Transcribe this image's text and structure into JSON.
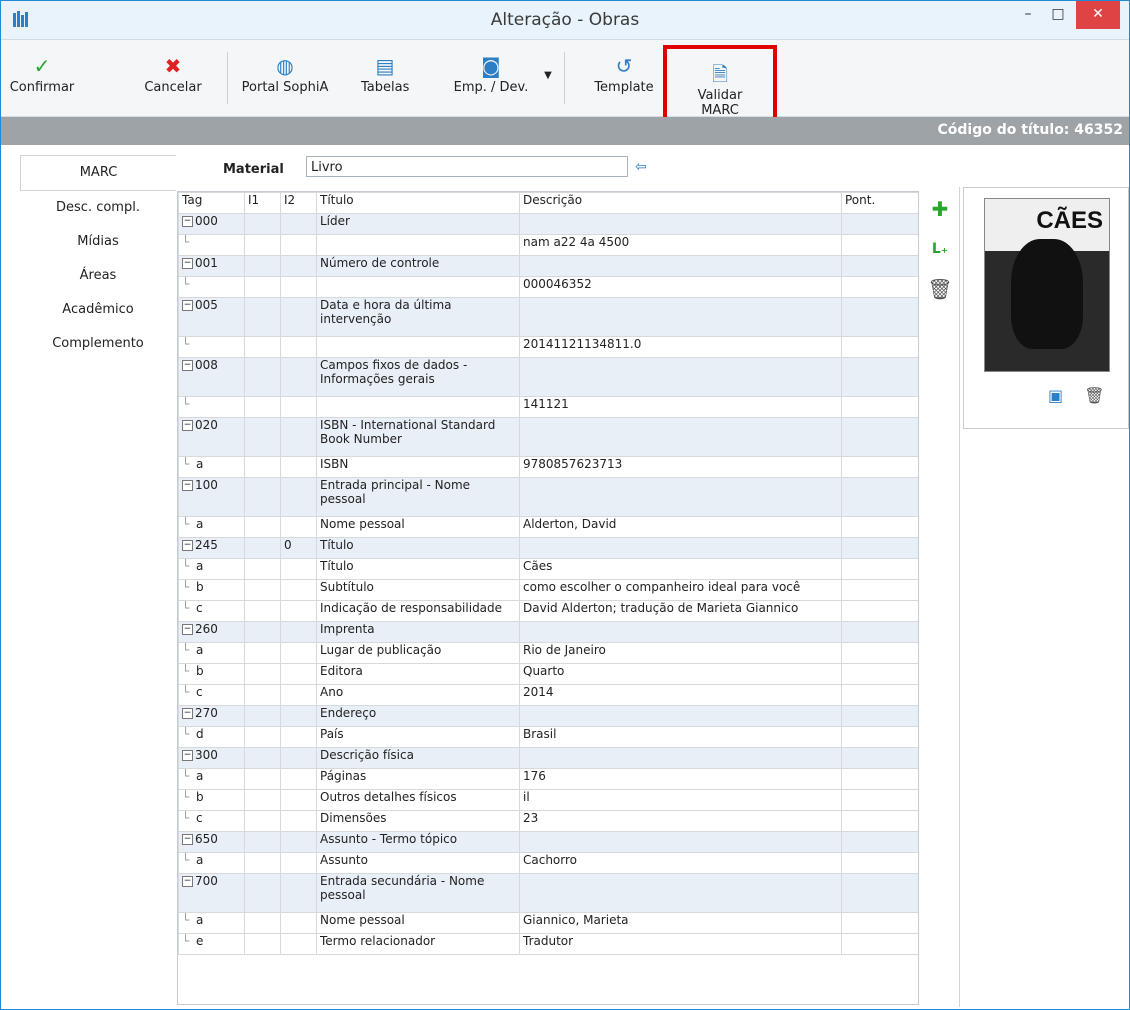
{
  "window": {
    "title": "Alteração - Obras"
  },
  "toolbar": {
    "confirmar": "Confirmar",
    "cancelar": "Cancelar",
    "portal": "Portal SophiA",
    "tabelas": "Tabelas",
    "emp": "Emp. / Dev.",
    "template": "Template",
    "validar": "Validar MARC"
  },
  "header": {
    "codigo": "Código do título: 46352"
  },
  "sidebar": {
    "items": [
      {
        "label": "MARC"
      },
      {
        "label": "Desc. compl."
      },
      {
        "label": "Mídias"
      },
      {
        "label": "Áreas"
      },
      {
        "label": "Acadêmico"
      },
      {
        "label": "Complemento"
      }
    ]
  },
  "material": {
    "label": "Material",
    "value": "Livro"
  },
  "grid": {
    "headers": {
      "tag": "Tag",
      "i1": "I1",
      "i2": "I2",
      "titulo": "Título",
      "descricao": "Descrição",
      "pont": "Pont."
    },
    "rows": [
      {
        "type": "field",
        "tag": "000",
        "i1": "",
        "i2": "",
        "titulo": "Líder",
        "descricao": ""
      },
      {
        "type": "sub",
        "tag": "",
        "i1": "",
        "i2": "",
        "titulo": "",
        "descricao": "nam a22    4a 4500"
      },
      {
        "type": "field",
        "tag": "001",
        "i1": "",
        "i2": "",
        "titulo": "Número de controle",
        "descricao": ""
      },
      {
        "type": "sub",
        "tag": "",
        "i1": "",
        "i2": "",
        "titulo": "",
        "descricao": "000046352"
      },
      {
        "type": "field",
        "tag": "005",
        "i1": "",
        "i2": "",
        "titulo": "Data e hora da última intervenção",
        "descricao": ""
      },
      {
        "type": "sub",
        "tag": "",
        "i1": "",
        "i2": "",
        "titulo": "",
        "descricao": "20141121134811.0"
      },
      {
        "type": "field",
        "tag": "008",
        "i1": "",
        "i2": "",
        "titulo": "Campos fixos de dados - Informações gerais",
        "descricao": ""
      },
      {
        "type": "sub",
        "tag": "",
        "i1": "",
        "i2": "",
        "titulo": "",
        "descricao": "141121"
      },
      {
        "type": "field",
        "tag": "020",
        "i1": "",
        "i2": "",
        "titulo": "ISBN - International Standard Book Number",
        "descricao": ""
      },
      {
        "type": "sub",
        "tag": "a",
        "i1": "",
        "i2": "",
        "titulo": "ISBN",
        "descricao": "9780857623713"
      },
      {
        "type": "field",
        "tag": "100",
        "i1": "",
        "i2": "",
        "titulo": "Entrada principal - Nome pessoal",
        "descricao": ""
      },
      {
        "type": "sub",
        "tag": "a",
        "i1": "",
        "i2": "",
        "titulo": "Nome pessoal",
        "descricao": "Alderton, David"
      },
      {
        "type": "field",
        "tag": "245",
        "i1": "",
        "i2": "0",
        "titulo": "Título",
        "descricao": ""
      },
      {
        "type": "sub",
        "tag": "a",
        "i1": "",
        "i2": "",
        "titulo": "Título",
        "descricao": "Cães"
      },
      {
        "type": "sub",
        "tag": "b",
        "i1": "",
        "i2": "",
        "titulo": "Subtítulo",
        "descricao": "como escolher o companheiro ideal para você"
      },
      {
        "type": "sub",
        "tag": "c",
        "i1": "",
        "i2": "",
        "titulo": "Indicação de responsabilidade",
        "descricao": "David Alderton; tradução de Marieta Giannico"
      },
      {
        "type": "field",
        "tag": "260",
        "i1": "",
        "i2": "",
        "titulo": "Imprenta",
        "descricao": ""
      },
      {
        "type": "sub",
        "tag": "a",
        "i1": "",
        "i2": "",
        "titulo": "Lugar de publicação",
        "descricao": "Rio de Janeiro"
      },
      {
        "type": "sub",
        "tag": "b",
        "i1": "",
        "i2": "",
        "titulo": "Editora",
        "descricao": "Quarto"
      },
      {
        "type": "sub",
        "tag": "c",
        "i1": "",
        "i2": "",
        "titulo": "Ano",
        "descricao": "2014"
      },
      {
        "type": "field",
        "tag": "270",
        "i1": "",
        "i2": "",
        "titulo": "Endereço",
        "descricao": ""
      },
      {
        "type": "sub",
        "tag": "d",
        "i1": "",
        "i2": "",
        "titulo": "País",
        "descricao": "Brasil"
      },
      {
        "type": "field",
        "tag": "300",
        "i1": "",
        "i2": "",
        "titulo": "Descrição física",
        "descricao": ""
      },
      {
        "type": "sub",
        "tag": "a",
        "i1": "",
        "i2": "",
        "titulo": "Páginas",
        "descricao": "176"
      },
      {
        "type": "sub",
        "tag": "b",
        "i1": "",
        "i2": "",
        "titulo": "Outros detalhes físicos",
        "descricao": "il"
      },
      {
        "type": "sub",
        "tag": "c",
        "i1": "",
        "i2": "",
        "titulo": "Dimensões",
        "descricao": "23"
      },
      {
        "type": "field",
        "tag": "650",
        "i1": "",
        "i2": "",
        "titulo": "Assunto - Termo tópico",
        "descricao": ""
      },
      {
        "type": "sub",
        "tag": "a",
        "i1": "",
        "i2": "",
        "titulo": "Assunto",
        "descricao": "Cachorro"
      },
      {
        "type": "field",
        "tag": "700",
        "i1": "",
        "i2": "",
        "titulo": "Entrada secundária - Nome pessoal",
        "descricao": ""
      },
      {
        "type": "sub",
        "tag": "a",
        "i1": "",
        "i2": "",
        "titulo": "Nome pessoal",
        "descricao": "Giannico, Marieta"
      },
      {
        "type": "sub",
        "tag": "e",
        "i1": "",
        "i2": "",
        "titulo": "Termo relacionador",
        "descricao": "Tradutor"
      }
    ]
  },
  "cover": {
    "title": "CÃES"
  },
  "colors": {
    "accent": "#2c7fc4",
    "highlight": "#e00000",
    "field_row": "#e8eff7",
    "grey_bar": "#9ea3a8"
  }
}
